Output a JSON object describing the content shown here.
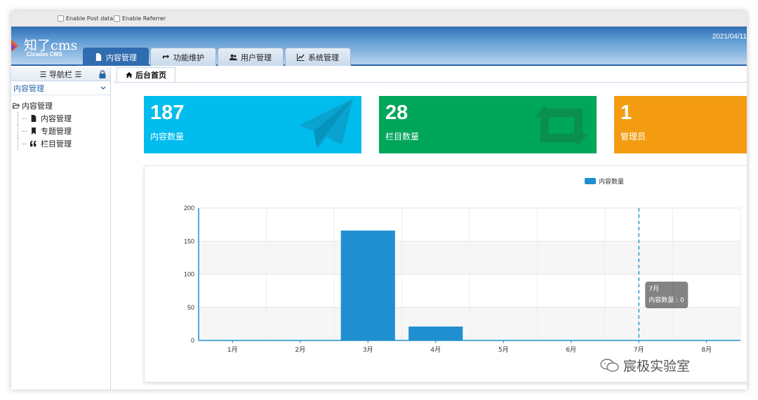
{
  "topbar": {
    "options": [
      {
        "label": "Enable Post data",
        "checked": false
      },
      {
        "label": "Enable Referrer",
        "checked": false
      }
    ]
  },
  "header": {
    "logo_title": "知了cms",
    "logo_subtitle": "Cicadas CMS",
    "date": "2021/04/11",
    "tabs": [
      {
        "label": "内容管理",
        "icon": "file-icon",
        "active": true
      },
      {
        "label": "功能维护",
        "icon": "retweet-icon",
        "active": false
      },
      {
        "label": "用户管理",
        "icon": "users-icon",
        "active": false
      },
      {
        "label": "系统管理",
        "icon": "line-chart-icon",
        "active": false
      }
    ]
  },
  "sidebar": {
    "title": "☰ 导航栏 ☰",
    "select_value": "内容管理",
    "tree": {
      "root": "内容管理",
      "children": [
        {
          "label": "内容管理",
          "icon": "file-icon"
        },
        {
          "label": "专题管理",
          "icon": "bookmark-icon"
        },
        {
          "label": "栏目管理",
          "icon": "quote-icon"
        }
      ]
    }
  },
  "content": {
    "tab_label": "后台首页",
    "cards": [
      {
        "value": "187",
        "label": "内容数量",
        "color": "#00bdee",
        "icon": "paper-plane-icon"
      },
      {
        "value": "28",
        "label": "栏目数量",
        "color": "#00a65a",
        "icon": "retweet-icon"
      },
      {
        "value": "1",
        "label": "管理员",
        "color": "#f39c12",
        "icon": "user-icon"
      }
    ]
  },
  "chart_data": {
    "type": "bar",
    "categories": [
      "1月",
      "2月",
      "3月",
      "4月",
      "5月",
      "6月",
      "7月",
      "8月"
    ],
    "series": [
      {
        "name": "内容数量",
        "values": [
          0,
          0,
          166,
          21,
          0,
          0,
          0,
          0
        ],
        "color": "#1f8fd0"
      }
    ],
    "ylim": [
      0,
      200
    ],
    "yticks": [
      0,
      50,
      100,
      150,
      200
    ],
    "grid": true,
    "legend": "top-center",
    "tooltip": {
      "title": "7月",
      "text": "内容数量 : 0",
      "category": "7月"
    }
  },
  "watermark": "宸极实验室"
}
